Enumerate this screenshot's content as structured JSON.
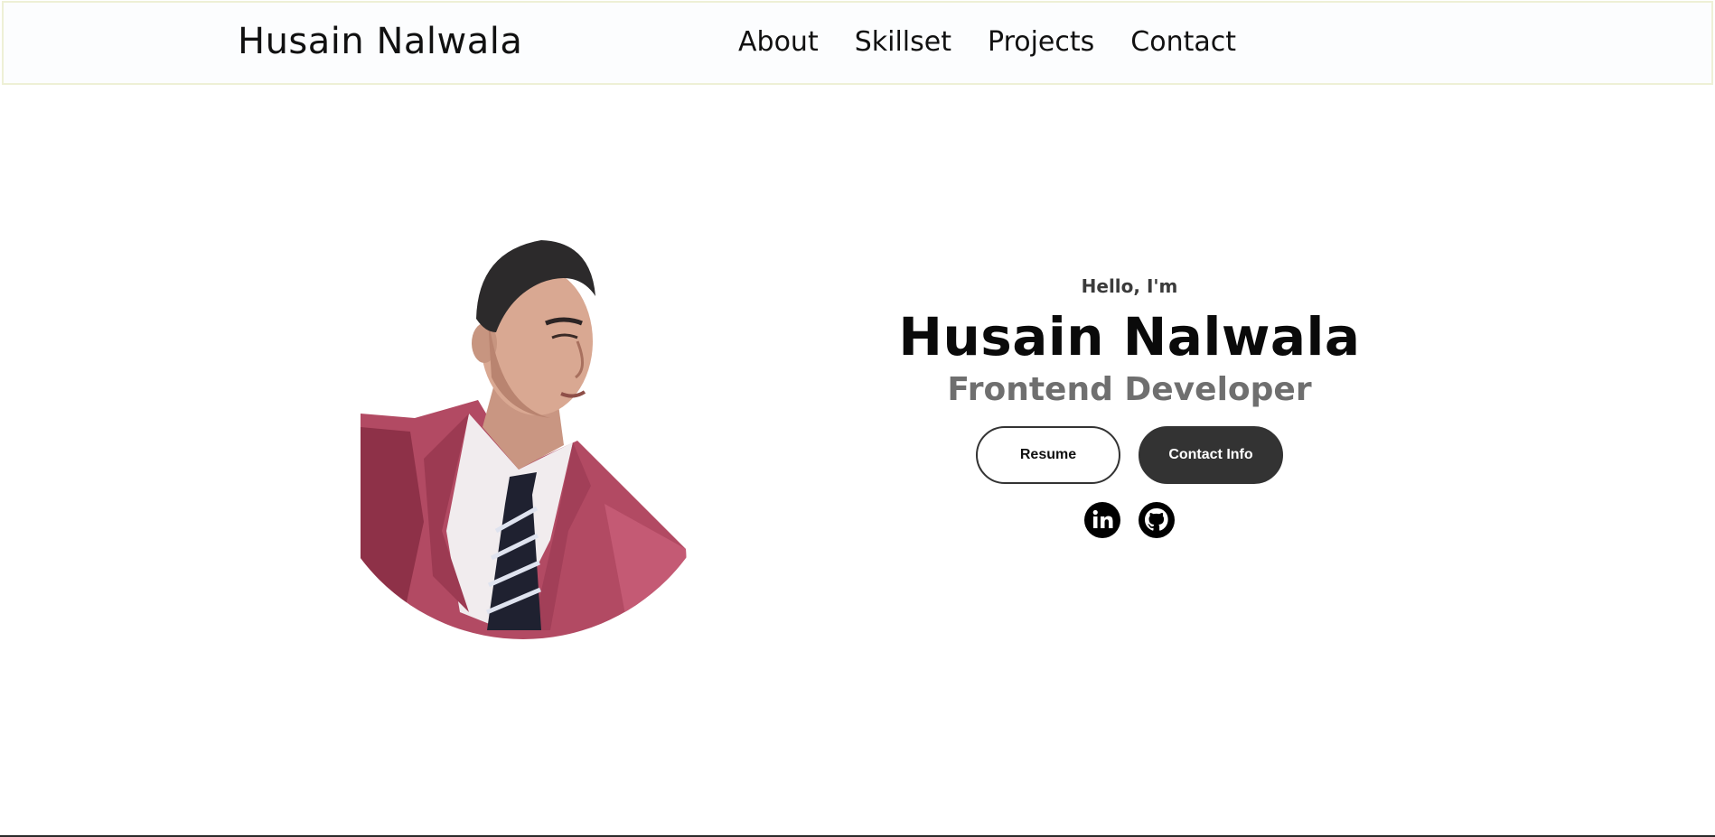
{
  "navbar": {
    "brand": "Husain Nalwala",
    "links": [
      "About",
      "Skillset",
      "Projects",
      "Contact"
    ]
  },
  "hero": {
    "greeting": "Hello, I'm",
    "name": "Husain Nalwala",
    "role": "Frontend Developer",
    "buttons": {
      "resume": "Resume",
      "contact": "Contact Info"
    },
    "social_icons": [
      "linkedin-icon",
      "github-icon"
    ]
  },
  "colors": {
    "nav_bg": "#fcfdfe",
    "nav_border": "#eef0d6",
    "button_dark": "#333333",
    "role_text": "#6f6f6f",
    "blazer": "#b24a63"
  }
}
